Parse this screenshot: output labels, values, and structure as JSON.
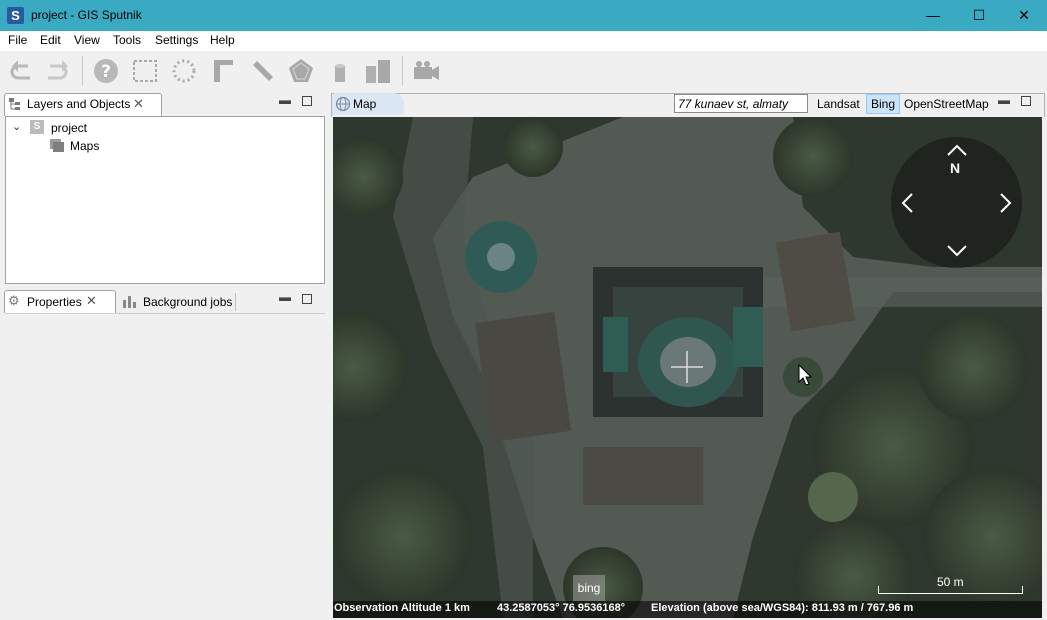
{
  "window": {
    "title": "project - GIS Sputnik",
    "app_icon_letter": "S",
    "minimize_glyph": "—",
    "maximize_glyph": "☐",
    "close_glyph": "✕"
  },
  "menu": [
    "File",
    "Edit",
    "View",
    "Tools",
    "Settings",
    "Help"
  ],
  "toolbar": {
    "icons": [
      "undo-icon",
      "redo-icon",
      "help-icon",
      "select-rectangle-icon",
      "select-polygon-icon",
      "ruler-angle-icon",
      "measure-distance-icon",
      "polygon-icon",
      "cylinder-icon",
      "buildings-icon",
      "camera-icon"
    ]
  },
  "layers_panel": {
    "tab_label": "Layers and Objects",
    "tree": {
      "project_label": "project",
      "project_icon_letter": "S",
      "maps_label": "Maps"
    }
  },
  "properties_panel": {
    "tab_label": "Properties",
    "jobs_tab_label": "Background jobs"
  },
  "map_panel": {
    "tab_label": "Map",
    "search_value": "77 kunaev st, almaty",
    "providers": [
      "Landsat",
      "Bing",
      "OpenStreetMap"
    ],
    "active_provider": "Bing",
    "nav": {
      "north_label": "N"
    },
    "bing_logo": "bing",
    "scale_label": "50 m",
    "status": {
      "altitude": "Observation Altitude 1 km",
      "coordinates": "43.2587053° 76.9536168°",
      "elevation": "Elevation (above sea/WGS84): 811.93 m / 767.96 m"
    }
  },
  "colors": {
    "titlebar": "#3aaac3",
    "active_provider_bg": "#cce4f7",
    "map_tab_bg": "#dbe7f5"
  }
}
